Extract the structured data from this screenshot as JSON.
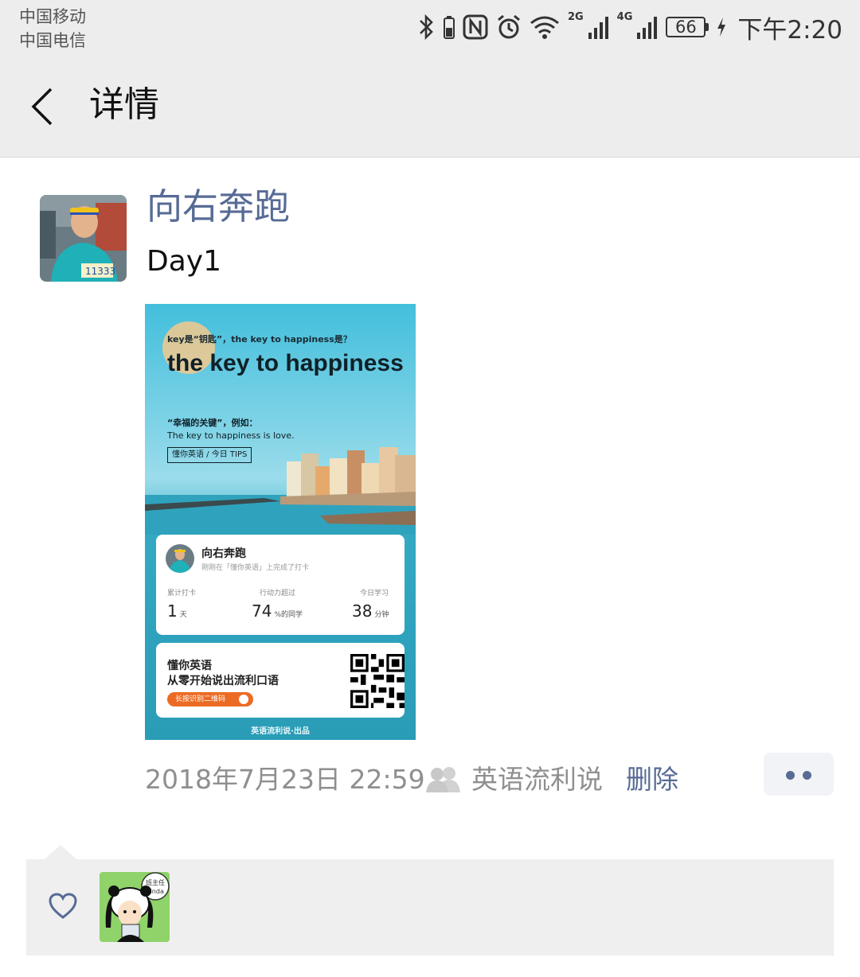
{
  "status_bar": {
    "carrier_1": "中国移动",
    "carrier_2": "中国电信",
    "signal_1_label": "2G",
    "signal_2_label": "4G",
    "battery": "66",
    "time": "下午2:20"
  },
  "header": {
    "title": "详情",
    "back_icon": "chevron-left-icon"
  },
  "post": {
    "author": "向右奔跑",
    "text": "Day1",
    "timestamp": "2018年7月23日 22:59",
    "source": "英语流利说",
    "delete_label": "删除",
    "more_icon": "more-dots-icon"
  },
  "shared_image": {
    "question": "key是“钥匙”，the key to happiness是？",
    "headline": "the key to happiness",
    "meaning": "“幸福的关键”，例如：",
    "example": "The key to happiness is love.",
    "tag": "懂你英语 / 今日 TIPS",
    "card_name": "向右奔跑",
    "card_subtitle": "刚刚在「懂你英语」上完成了打卡",
    "stats": [
      {
        "label": "累计打卡",
        "value": "1",
        "unit": "天"
      },
      {
        "label": "行动力超过",
        "value": "74",
        "unit": "%的同学"
      },
      {
        "label": "今日学习",
        "value": "38",
        "unit": "分钟"
      }
    ],
    "promo_title": "懂你英语",
    "promo_subtitle": "从零开始说出流利口语",
    "promo_button": "长按识别二维码",
    "footer": "英语流利说·出品"
  },
  "likes": {
    "icon": "heart-outline-icon",
    "liker_badge": "班主任 Linda"
  },
  "colors": {
    "link_blue": "#576b95",
    "meta_gray": "#8f8f8f",
    "bar_bg": "#ededed",
    "likes_bg": "#efefef",
    "promo_orange": "#ec6b24"
  }
}
